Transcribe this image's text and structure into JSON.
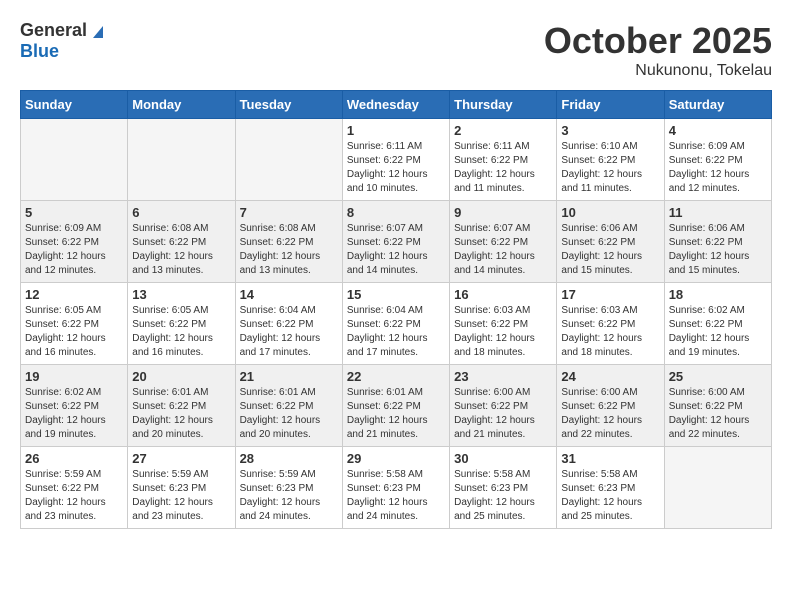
{
  "header": {
    "logo": {
      "general": "General",
      "blue": "Blue"
    },
    "title": "October 2025",
    "location": "Nukunonu, Tokelau"
  },
  "weekdays": [
    "Sunday",
    "Monday",
    "Tuesday",
    "Wednesday",
    "Thursday",
    "Friday",
    "Saturday"
  ],
  "weeks": [
    [
      {
        "day": "",
        "info": ""
      },
      {
        "day": "",
        "info": ""
      },
      {
        "day": "",
        "info": ""
      },
      {
        "day": "1",
        "info": "Sunrise: 6:11 AM\nSunset: 6:22 PM\nDaylight: 12 hours\nand 10 minutes."
      },
      {
        "day": "2",
        "info": "Sunrise: 6:11 AM\nSunset: 6:22 PM\nDaylight: 12 hours\nand 11 minutes."
      },
      {
        "day": "3",
        "info": "Sunrise: 6:10 AM\nSunset: 6:22 PM\nDaylight: 12 hours\nand 11 minutes."
      },
      {
        "day": "4",
        "info": "Sunrise: 6:09 AM\nSunset: 6:22 PM\nDaylight: 12 hours\nand 12 minutes."
      }
    ],
    [
      {
        "day": "5",
        "info": "Sunrise: 6:09 AM\nSunset: 6:22 PM\nDaylight: 12 hours\nand 12 minutes."
      },
      {
        "day": "6",
        "info": "Sunrise: 6:08 AM\nSunset: 6:22 PM\nDaylight: 12 hours\nand 13 minutes."
      },
      {
        "day": "7",
        "info": "Sunrise: 6:08 AM\nSunset: 6:22 PM\nDaylight: 12 hours\nand 13 minutes."
      },
      {
        "day": "8",
        "info": "Sunrise: 6:07 AM\nSunset: 6:22 PM\nDaylight: 12 hours\nand 14 minutes."
      },
      {
        "day": "9",
        "info": "Sunrise: 6:07 AM\nSunset: 6:22 PM\nDaylight: 12 hours\nand 14 minutes."
      },
      {
        "day": "10",
        "info": "Sunrise: 6:06 AM\nSunset: 6:22 PM\nDaylight: 12 hours\nand 15 minutes."
      },
      {
        "day": "11",
        "info": "Sunrise: 6:06 AM\nSunset: 6:22 PM\nDaylight: 12 hours\nand 15 minutes."
      }
    ],
    [
      {
        "day": "12",
        "info": "Sunrise: 6:05 AM\nSunset: 6:22 PM\nDaylight: 12 hours\nand 16 minutes."
      },
      {
        "day": "13",
        "info": "Sunrise: 6:05 AM\nSunset: 6:22 PM\nDaylight: 12 hours\nand 16 minutes."
      },
      {
        "day": "14",
        "info": "Sunrise: 6:04 AM\nSunset: 6:22 PM\nDaylight: 12 hours\nand 17 minutes."
      },
      {
        "day": "15",
        "info": "Sunrise: 6:04 AM\nSunset: 6:22 PM\nDaylight: 12 hours\nand 17 minutes."
      },
      {
        "day": "16",
        "info": "Sunrise: 6:03 AM\nSunset: 6:22 PM\nDaylight: 12 hours\nand 18 minutes."
      },
      {
        "day": "17",
        "info": "Sunrise: 6:03 AM\nSunset: 6:22 PM\nDaylight: 12 hours\nand 18 minutes."
      },
      {
        "day": "18",
        "info": "Sunrise: 6:02 AM\nSunset: 6:22 PM\nDaylight: 12 hours\nand 19 minutes."
      }
    ],
    [
      {
        "day": "19",
        "info": "Sunrise: 6:02 AM\nSunset: 6:22 PM\nDaylight: 12 hours\nand 19 minutes."
      },
      {
        "day": "20",
        "info": "Sunrise: 6:01 AM\nSunset: 6:22 PM\nDaylight: 12 hours\nand 20 minutes."
      },
      {
        "day": "21",
        "info": "Sunrise: 6:01 AM\nSunset: 6:22 PM\nDaylight: 12 hours\nand 20 minutes."
      },
      {
        "day": "22",
        "info": "Sunrise: 6:01 AM\nSunset: 6:22 PM\nDaylight: 12 hours\nand 21 minutes."
      },
      {
        "day": "23",
        "info": "Sunrise: 6:00 AM\nSunset: 6:22 PM\nDaylight: 12 hours\nand 21 minutes."
      },
      {
        "day": "24",
        "info": "Sunrise: 6:00 AM\nSunset: 6:22 PM\nDaylight: 12 hours\nand 22 minutes."
      },
      {
        "day": "25",
        "info": "Sunrise: 6:00 AM\nSunset: 6:22 PM\nDaylight: 12 hours\nand 22 minutes."
      }
    ],
    [
      {
        "day": "26",
        "info": "Sunrise: 5:59 AM\nSunset: 6:22 PM\nDaylight: 12 hours\nand 23 minutes."
      },
      {
        "day": "27",
        "info": "Sunrise: 5:59 AM\nSunset: 6:23 PM\nDaylight: 12 hours\nand 23 minutes."
      },
      {
        "day": "28",
        "info": "Sunrise: 5:59 AM\nSunset: 6:23 PM\nDaylight: 12 hours\nand 24 minutes."
      },
      {
        "day": "29",
        "info": "Sunrise: 5:58 AM\nSunset: 6:23 PM\nDaylight: 12 hours\nand 24 minutes."
      },
      {
        "day": "30",
        "info": "Sunrise: 5:58 AM\nSunset: 6:23 PM\nDaylight: 12 hours\nand 25 minutes."
      },
      {
        "day": "31",
        "info": "Sunrise: 5:58 AM\nSunset: 6:23 PM\nDaylight: 12 hours\nand 25 minutes."
      },
      {
        "day": "",
        "info": ""
      }
    ]
  ]
}
